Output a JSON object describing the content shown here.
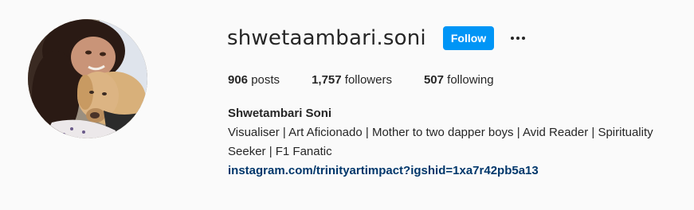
{
  "profile": {
    "username": "shwetaambari.soni",
    "follow_label": "Follow",
    "more_icon": "more-horizontal-icon",
    "accent_color": "#0095f6",
    "link_color": "#00376b"
  },
  "stats": {
    "posts_count": "906",
    "posts_label": "posts",
    "followers_count": "1,757",
    "followers_label": "followers",
    "following_count": "507",
    "following_label": "following"
  },
  "bio": {
    "full_name": "Shwetambari Soni",
    "line1": "Visualiser | Art Aficionado | Mother to two dapper boys | Avid Reader | Spirituality",
    "line2": "Seeker | F1 Fanatic",
    "link": "instagram.com/trinityartimpact?igshid=1xa7r42pb5a13"
  }
}
